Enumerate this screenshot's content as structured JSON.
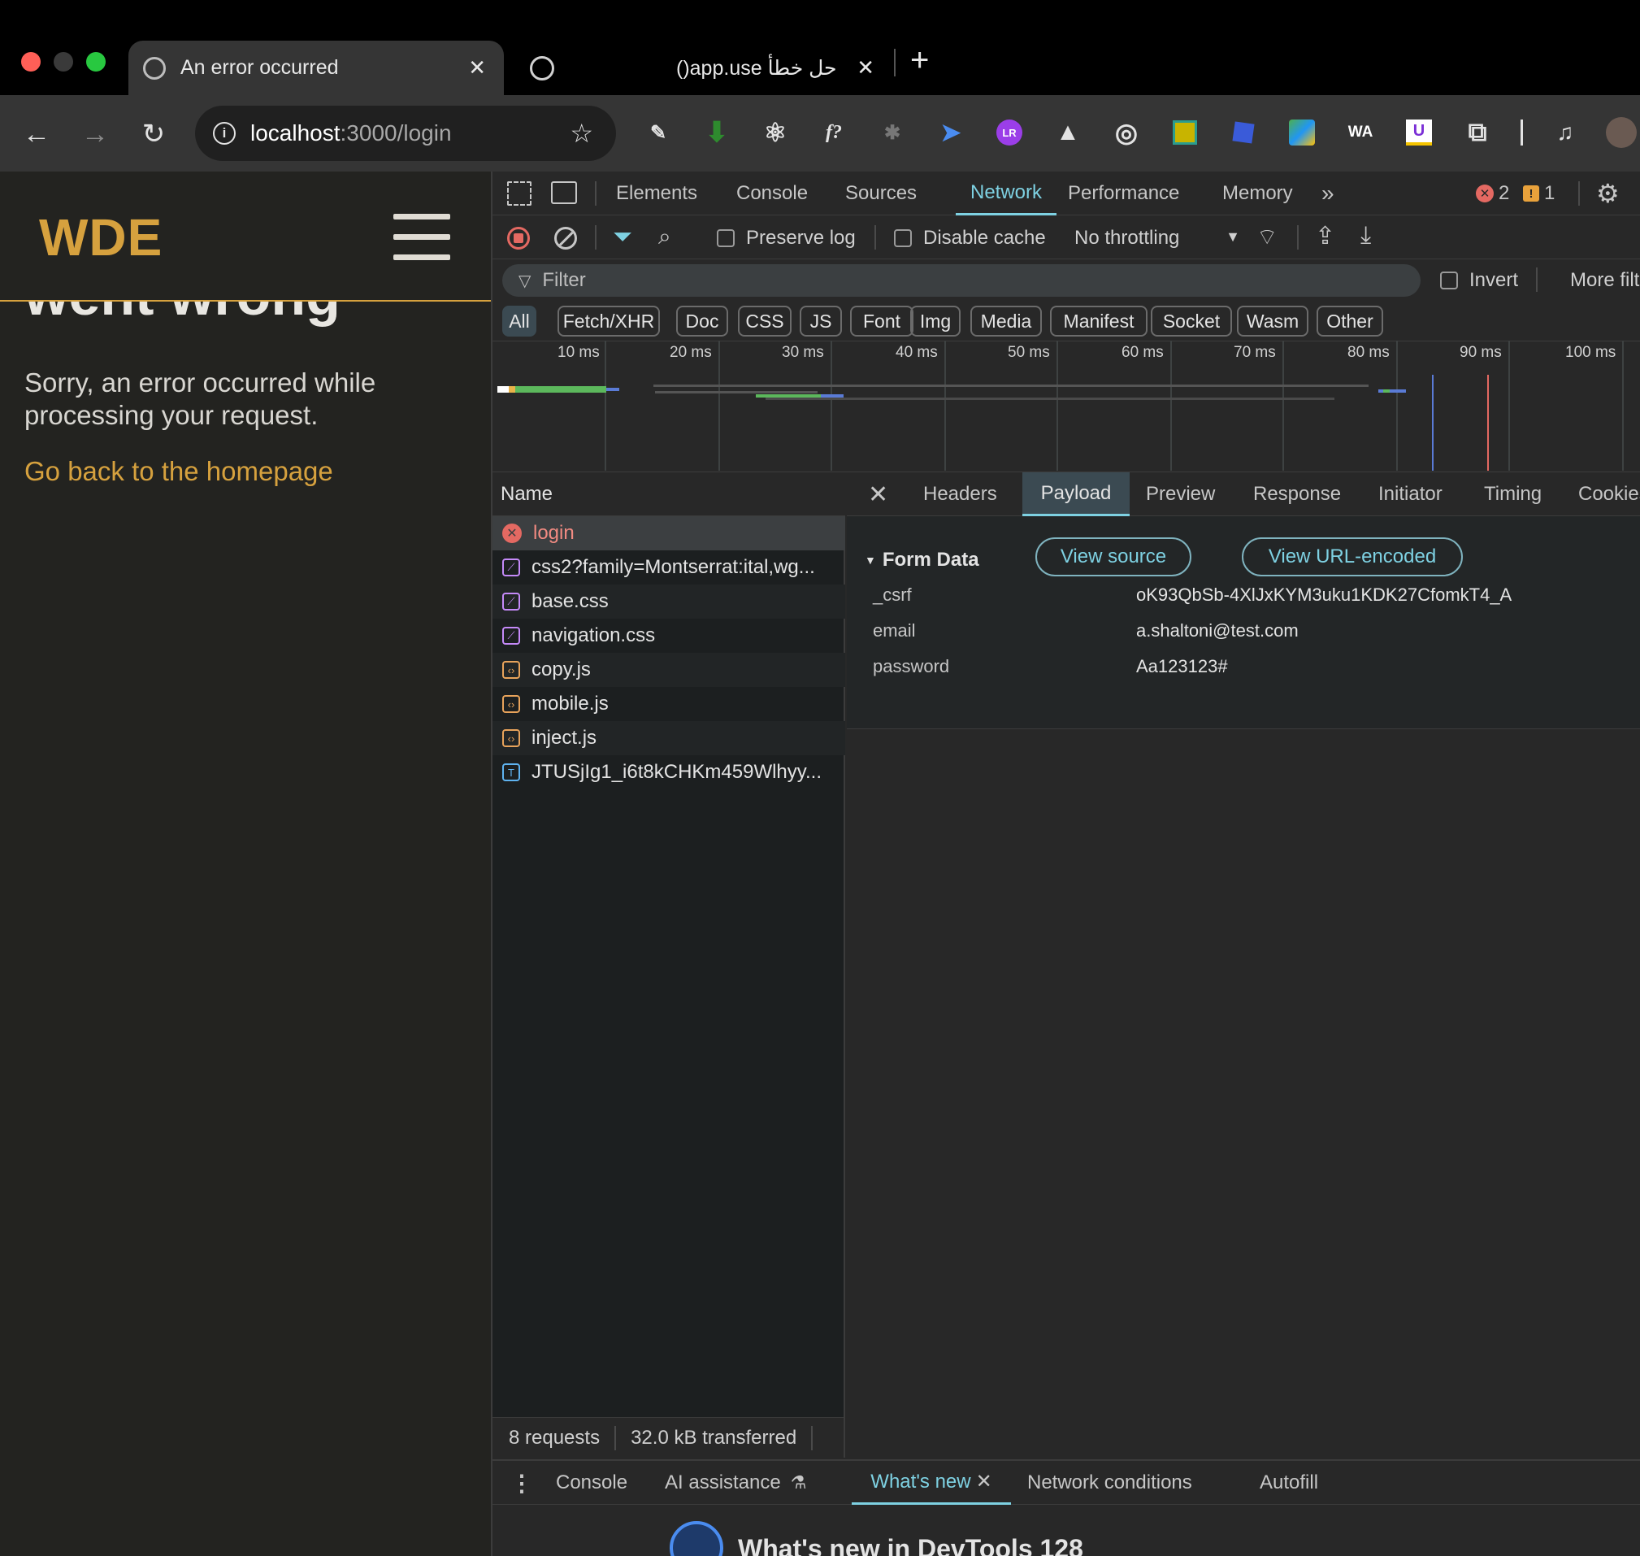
{
  "browser": {
    "tabs": [
      {
        "title": "An error occurred",
        "close": "✕"
      },
      {
        "title": "حل خطأ app.use()",
        "close": "✕"
      }
    ],
    "new_tab": "+",
    "url_host": "localhost",
    "url_path": ":3000/login",
    "extensions": [
      "eyedropper-icon",
      "download-arrow-icon",
      "react-icon",
      "fx-icon",
      "bug-icon",
      "cursor-icon",
      "lr-icon",
      "mountain-icon",
      "target-icon",
      "chip-icon",
      "blocks-icon",
      "map-icon",
      "wa-icon",
      "u-icon",
      "puzzle-icon",
      "playlist-icon",
      "profile-avatar"
    ],
    "ext_labels": {
      "fx": "f?",
      "wa": "WA",
      "u": "U",
      "lr": "LR"
    }
  },
  "site": {
    "logo": "WDE",
    "heading": "went wrong",
    "message": "Sorry, an error occurred while processing your request.",
    "link": "Go back to the homepage"
  },
  "devtools": {
    "main_tabs": [
      "Elements",
      "Console",
      "Sources",
      "Network",
      "Performance",
      "Memory"
    ],
    "active_main_tab": "Network",
    "errors_count": "2",
    "warnings_count": "1",
    "toolbar": {
      "preserve_log": "Preserve log",
      "disable_cache": "Disable cache",
      "throttling": "No throttling"
    },
    "filter": {
      "placeholder": "Filter",
      "invert": "Invert",
      "more": "More filters"
    },
    "chips": [
      "All",
      "Fetch/XHR",
      "Doc",
      "CSS",
      "JS",
      "Font",
      "Img",
      "Media",
      "Manifest",
      "Socket",
      "Wasm",
      "Other"
    ],
    "active_chip": "All",
    "timeline_ticks": [
      "10 ms",
      "20 ms",
      "30 ms",
      "40 ms",
      "50 ms",
      "60 ms",
      "70 ms",
      "80 ms",
      "90 ms",
      "100 ms"
    ],
    "name_header": "Name",
    "requests": [
      {
        "name": "login",
        "type": "error"
      },
      {
        "name": "css2?family=Montserrat:ital,wg...",
        "type": "css"
      },
      {
        "name": "base.css",
        "type": "css"
      },
      {
        "name": "navigation.css",
        "type": "css"
      },
      {
        "name": "copy.js",
        "type": "js"
      },
      {
        "name": "mobile.js",
        "type": "js"
      },
      {
        "name": "inject.js",
        "type": "js"
      },
      {
        "name": "JTUSjIg1_i6t8kCHKm459Wlhyy...",
        "type": "font"
      }
    ],
    "detail_tabs": [
      "Headers",
      "Payload",
      "Preview",
      "Response",
      "Initiator",
      "Timing",
      "Cookies"
    ],
    "active_detail_tab": "Payload",
    "payload": {
      "section": "Form Data",
      "view_source": "View source",
      "view_url_encoded": "View URL-encoded",
      "fields": [
        {
          "key": "_csrf",
          "value": "oK93QbSb-4XlJxKYM3uku1KDK27CfomkT4_A"
        },
        {
          "key": "email",
          "value": "a.shaltoni@test.com"
        },
        {
          "key": "password",
          "value": "Aa123123#"
        }
      ]
    },
    "status": {
      "requests": "8 requests",
      "transferred": "32.0 kB transferred"
    },
    "drawer_tabs": [
      "Console",
      "AI assistance",
      "What's new",
      "Network conditions",
      "Autofill"
    ],
    "active_drawer_tab": "What's new",
    "whats_new_title": "What's new in DevTools 128"
  }
}
